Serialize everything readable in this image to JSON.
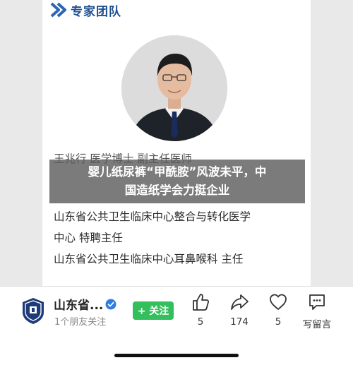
{
  "section": {
    "title": "专家团队",
    "icon": "chevron-right-icon"
  },
  "expert": {
    "avatar_icon": "person-portrait",
    "lines": [
      "王兆行  医学博士  副主任医师",
      "山东省公共卫生临床中心整合与转化医学",
      "中心  特聘主任",
      "山东省公共卫生临床中心耳鼻喉科  主任"
    ]
  },
  "overlay": {
    "line1": "婴儿纸尿裤“甲酰胺”风波未平，中",
    "line2": "国造纸学会力挺企业"
  },
  "account": {
    "name": "山东省...",
    "followers": "1个朋友关注",
    "follow_label": "+ 关注",
    "verified_icon": "verified-badge-icon"
  },
  "actions": {
    "like_count": "5",
    "share_count": "174",
    "favorite_count": "5",
    "comment_label": "写留言"
  },
  "colors": {
    "brand_blue": "#1f4f8f",
    "follow_green": "#33bf5b",
    "verified_blue": "#2f7de1"
  }
}
